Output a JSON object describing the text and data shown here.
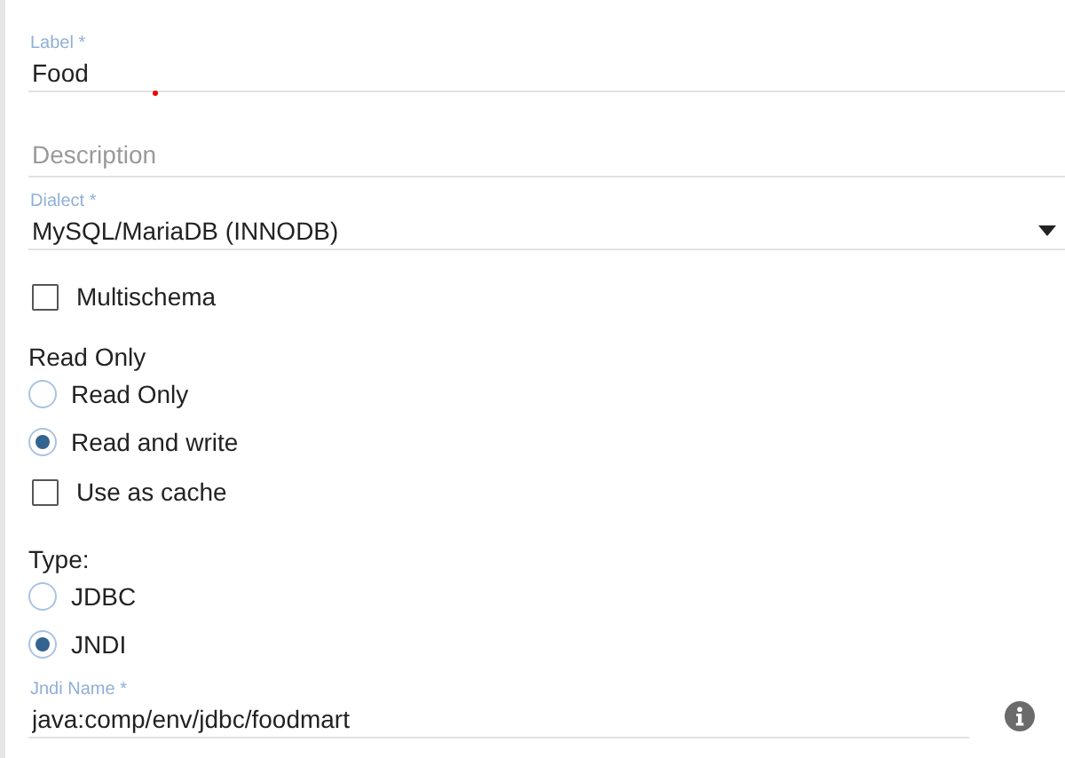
{
  "label_field": {
    "label": "Label *",
    "value": "Food"
  },
  "description_field": {
    "placeholder": "Description"
  },
  "dialect_field": {
    "label": "Dialect *",
    "value": "MySQL/MariaDB (INNODB)"
  },
  "multischema": {
    "label": "Multischema",
    "checked": false
  },
  "access_group": {
    "title": "Read Only",
    "options": [
      {
        "label": "Read Only",
        "selected": false
      },
      {
        "label": "Read and write",
        "selected": true
      }
    ]
  },
  "use_as_cache": {
    "label": "Use as cache",
    "checked": false
  },
  "type_group": {
    "title": "Type:",
    "options": [
      {
        "label": "JDBC",
        "selected": false
      },
      {
        "label": "JNDI",
        "selected": true
      }
    ]
  },
  "jndi_field": {
    "label": "Jndi Name *",
    "value": "java:comp/env/jdbc/foodmart"
  }
}
